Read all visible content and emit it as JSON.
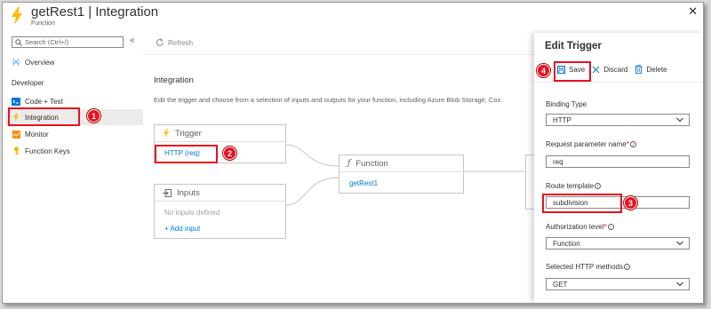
{
  "header": {
    "title": "getRest1 | Integration",
    "subtitle": "Function",
    "close": "✕"
  },
  "sidebar": {
    "search_placeholder": "Search (Ctrl+/)",
    "collapse": "«",
    "overview": "Overview",
    "section": "Developer",
    "items": [
      {
        "label": "Code + Test"
      },
      {
        "label": "Integration"
      },
      {
        "label": "Monitor"
      },
      {
        "label": "Function Keys"
      }
    ]
  },
  "toolbar": {
    "refresh": "Refresh"
  },
  "main": {
    "title": "Integration",
    "description": "Edit the trigger and choose from a selection of inputs and outputs for your function, including Azure Blob Storage, Cos"
  },
  "trigger": {
    "title": "Trigger",
    "link": "HTTP (req)"
  },
  "inputs": {
    "title": "Inputs",
    "empty": "No inputs defined",
    "add": "+ Add input"
  },
  "function": {
    "title": "Function",
    "link": "getRest1"
  },
  "panel": {
    "title": "Edit Trigger",
    "save": "Save",
    "discard": "Discard",
    "delete": "Delete",
    "binding_type_label": "Binding Type",
    "binding_type_value": "HTTP",
    "request_param_label": "Request parameter name",
    "request_param_value": "req",
    "route_template_label": "Route template",
    "route_template_value": "subdivision",
    "auth_level_label": "Authorization level",
    "auth_level_value": "Function",
    "methods_label": "Selected HTTP methods",
    "methods_value": "GET"
  },
  "callouts": [
    "1",
    "2",
    "3",
    "4"
  ],
  "colors": {
    "accent": "#0078d4",
    "callout": "#e81123",
    "bolt": "#ffb900"
  }
}
